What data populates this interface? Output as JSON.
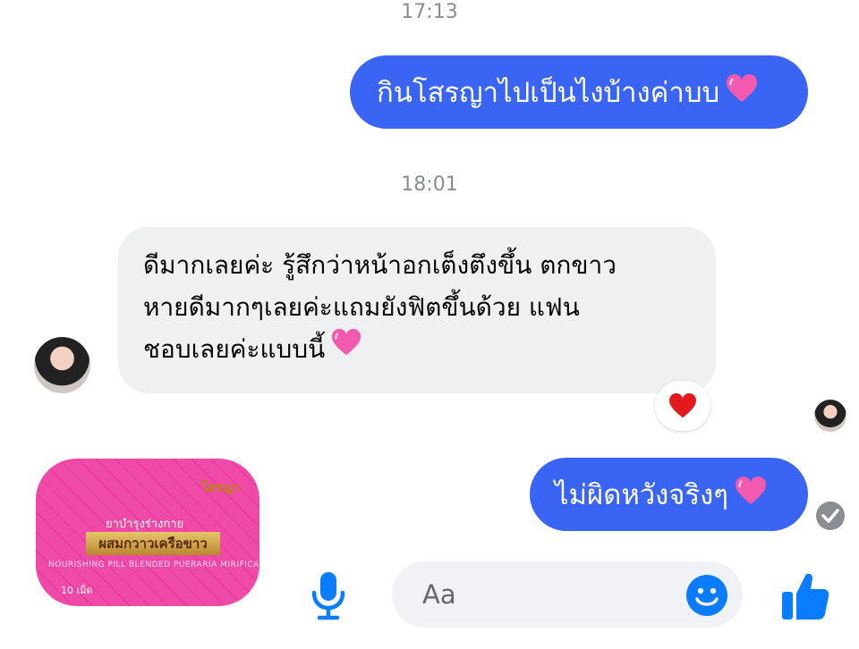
{
  "messages": {
    "time_1": "17:13",
    "outgoing_1": "กินโสรญาไปเป็นไงบ้างค่าบบ",
    "time_2": "18:01",
    "incoming_1_lines": [
      "ดีมากเลยค่ะ รู้สึกว่าหน้าอกเต็งตึงขึ้น ตกขาว",
      "หายดีมากๆเลยค่ะแถมยังฟิตขึ้นด้วย แฟน",
      "ชอบเลยค่ะแบบนี้"
    ],
    "incoming_1_reaction": "heart",
    "outgoing_2": "ไม่ผิดหวังจริงๆ"
  },
  "product_image": {
    "brand": "โสรญา",
    "line1": "ยาบำรุงร่างกาย",
    "band": "ผสมกวาวเครือขาว",
    "line2": "NOURISHING PILL BLENDED PUERARIA MIRIFICA",
    "net": "10 เม็ด"
  },
  "composer": {
    "placeholder": "Aa"
  },
  "icons": {
    "mic": "microphone-icon",
    "emoji": "smiley-icon",
    "like": "thumbs-up-icon",
    "seen": "checkmark-icon"
  },
  "colors": {
    "outgoing_bubble": "#3a64f4",
    "incoming_bubble": "#eff0f2",
    "accent": "#0a7cff"
  }
}
